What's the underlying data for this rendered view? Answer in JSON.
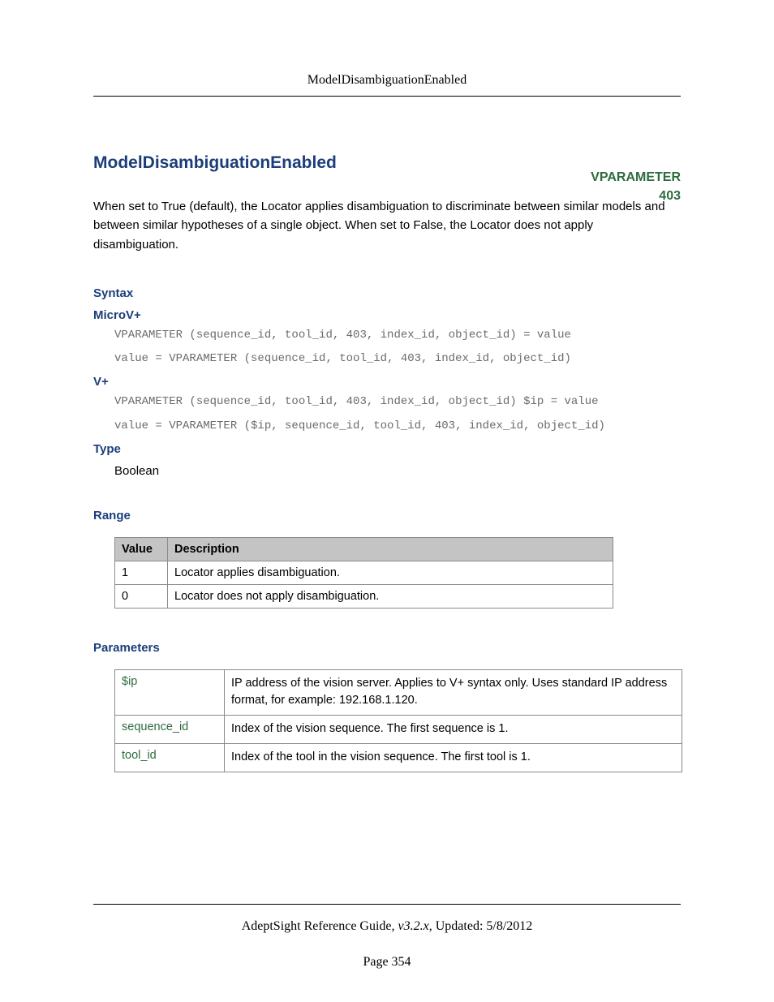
{
  "running_head": "ModelDisambiguationEnabled",
  "title": "ModelDisambiguationEnabled",
  "vparam": {
    "label": "VPARAMETER",
    "code": "403"
  },
  "intro": "When set to True (default), the Locator applies disambiguation to discriminate between similar models and between similar hypotheses of a single object. When set to False, the Locator does not apply disambiguation.",
  "sections": {
    "syntax": "Syntax",
    "microv": "MicroV+",
    "vplus": "V+",
    "type": "Type",
    "range": "Range",
    "parameters": "Parameters"
  },
  "code": {
    "microv1": "VPARAMETER (sequence_id, tool_id, 403, index_id, object_id) = value",
    "microv2": "value = VPARAMETER (sequence_id, tool_id, 403, index_id, object_id)",
    "vplus1": "VPARAMETER (sequence_id, tool_id, 403, index_id, object_id) $ip = value",
    "vplus2": "value = VPARAMETER ($ip, sequence_id, tool_id, 403, index_id, object_id)"
  },
  "type_value": "Boolean",
  "range_table": {
    "headers": {
      "value": "Value",
      "desc": "Description"
    },
    "rows": [
      {
        "value": "1",
        "desc": "Locator applies disambiguation."
      },
      {
        "value": "0",
        "desc": "Locator does not apply disambiguation."
      }
    ]
  },
  "params_table": {
    "rows": [
      {
        "name": "$ip",
        "desc": "IP address of the vision server. Applies to V+ syntax only. Uses standard IP address format, for example: 192.168.1.120."
      },
      {
        "name": "sequence_id",
        "desc": "Index of the vision sequence. The first sequence is 1."
      },
      {
        "name": "tool_id",
        "desc": "Index of the tool in the vision sequence. The first tool is 1."
      }
    ]
  },
  "footer": {
    "guide": "AdeptSight Reference Guide",
    "version": ", v3.2.x",
    "updated": ", Updated: 5/8/2012",
    "page": "Page 354"
  }
}
